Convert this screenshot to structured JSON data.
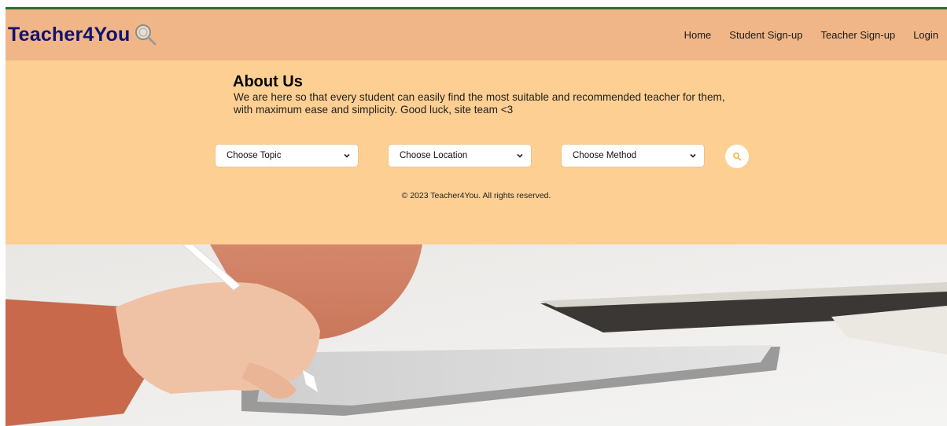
{
  "brand": {
    "name": "Teacher4You",
    "logo_icon": "magnifier-logo-icon"
  },
  "nav": {
    "items": [
      "Home",
      "Student Sign-up",
      "Teacher Sign-up",
      "Login"
    ]
  },
  "about": {
    "title": "About Us",
    "text": "We are here so that every student can easily find the most suitable and recommended teacher for them,\nwith maximum ease and simplicity. Good luck, site team <3"
  },
  "filters": {
    "topic": "Choose Topic",
    "location": "Choose Location",
    "method": "Choose Method",
    "search_icon": "search-icon"
  },
  "footer": {
    "copyright": "© 2023 Teacher4You. All rights reserved."
  },
  "colors": {
    "header_bg": "#f1b687",
    "main_bg": "#fecf92",
    "brand_text": "#12136e",
    "search_icon": "#f4b23a"
  }
}
